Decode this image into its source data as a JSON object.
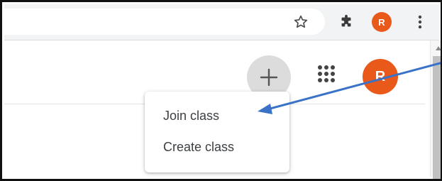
{
  "browser": {
    "profile_initial": "R",
    "icons": [
      "star-icon",
      "puzzle-icon",
      "menu-dots-icon"
    ]
  },
  "header": {
    "add_label": "+",
    "apps_icon": "apps-grid-icon",
    "account_initial": "R"
  },
  "menu": {
    "items": [
      {
        "label": "Join class"
      },
      {
        "label": "Create class"
      }
    ]
  },
  "colors": {
    "avatar": "#e8591a",
    "arrow": "#3a72c7",
    "add_button_bg": "#dcdcdc"
  }
}
